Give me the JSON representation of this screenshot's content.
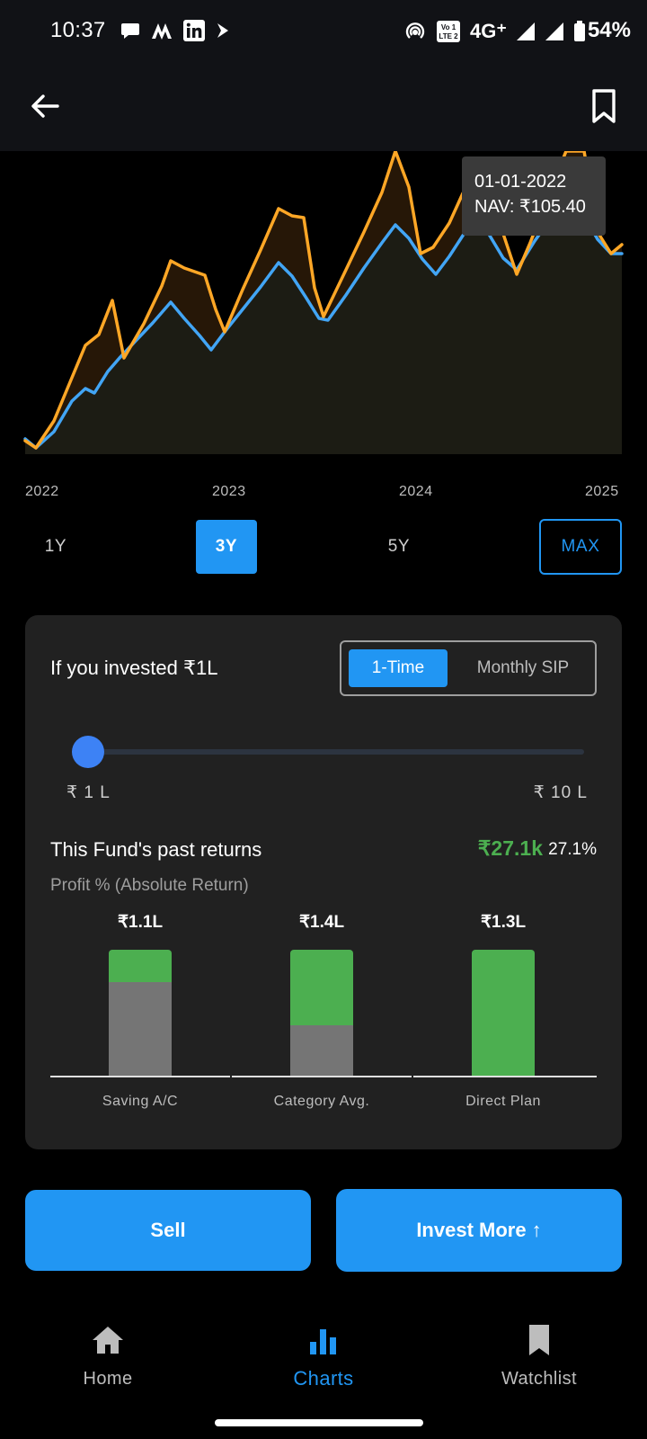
{
  "status_bar": {
    "time": "10:37",
    "network": "4G⁺",
    "volte": "Vo LTE 2",
    "battery": "54%",
    "icons": [
      "chat-icon",
      "m-icon",
      "linkedin-icon",
      "arrow-app-icon",
      "hotspot-icon",
      "volte-icon",
      "signal-icon",
      "signal-icon",
      "battery-icon"
    ]
  },
  "app_bar": {
    "back_icon": "back-arrow-icon",
    "bookmark_icon": "bookmark-icon"
  },
  "chart_data": {
    "type": "line",
    "x_ticks": [
      "2022",
      "2023",
      "2024",
      "2025"
    ],
    "series": [
      {
        "color": "#ffa726"
      },
      {
        "color": "#42a5f5"
      }
    ],
    "tooltip": {
      "date": "01-01-2022",
      "nav": "NAV: ₹105.40"
    }
  },
  "range_buttons": [
    {
      "label": "1Y",
      "state": "default"
    },
    {
      "label": "3Y",
      "state": "active"
    },
    {
      "label": "5Y",
      "state": "default"
    },
    {
      "label": "MAX",
      "state": "outlined"
    }
  ],
  "investment_card": {
    "title": "If you invested ₹1L",
    "toggle": {
      "active": "1-Time",
      "inactive": "Monthly SIP"
    },
    "slider": {
      "min_label": "₹ 1 L",
      "max_label": "₹ 10 L",
      "value_fraction": 0
    },
    "past_returns_label": "This Fund's past returns",
    "returns_amount": "₹27.1k",
    "returns_pct": "27.1%",
    "profit_label": "Profit % (Absolute Return)",
    "comparison_chart": {
      "type": "bar",
      "categories": [
        "Saving A/C",
        "Category Avg.",
        "Direct Plan"
      ],
      "value_labels": [
        "₹1.1L",
        "₹1.4L",
        "₹1.3L"
      ],
      "principal_fraction": [
        0.74,
        0.4,
        0
      ],
      "colors": {
        "gain": "#4caf50",
        "principal": "#757575"
      }
    }
  },
  "actions": {
    "sell": "Sell",
    "invest_more": "Invest More ↑"
  },
  "bottom_nav": [
    {
      "label": "Home",
      "icon": "home-icon",
      "active": false
    },
    {
      "label": "Charts",
      "icon": "bar-chart-icon",
      "active": true
    },
    {
      "label": "Watchlist",
      "icon": "bookmark-icon",
      "active": false
    }
  ],
  "colors": {
    "accent": "#2196f3",
    "gain": "#4caf50",
    "card": "#212121"
  }
}
